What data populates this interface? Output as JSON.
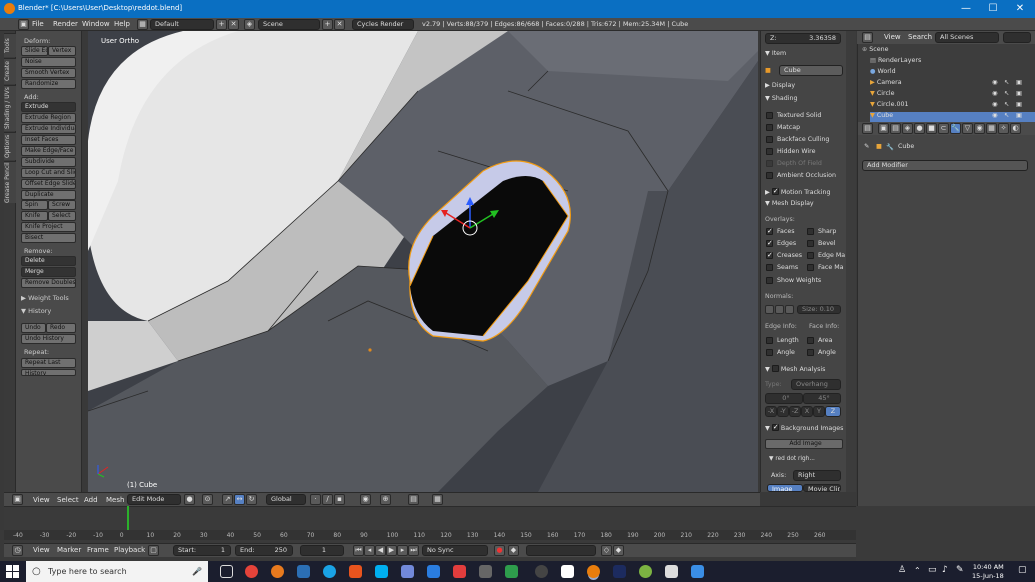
{
  "window": {
    "title": "Blender* [C:\\Users\\User\\Desktop\\reddot.blend]",
    "minimize": "—",
    "maximize": "☐",
    "close": "✕"
  },
  "menu": {
    "file": "File",
    "render": "Render",
    "window": "Window",
    "help": "Help",
    "screen_layout": "Default",
    "scene": "Scene",
    "engine": "Cycles Render",
    "stats": "v2.79 | Verts:88/379 | Edges:86/668 | Faces:0/288 | Tris:672 | Mem:25.34M | Cube"
  },
  "left_tabs": [
    "Tools",
    "Create",
    "Shading / UVs",
    "Options",
    "Grease Pencil"
  ],
  "toolshelf": {
    "deform": "Deform:",
    "slide_edge": "Slide Ed",
    "vertex": "Vertex",
    "noise": "Noise",
    "smooth_vertex": "Smooth Vertex",
    "randomize": "Randomize",
    "add": "Add:",
    "extrude": "Extrude",
    "extrude_region": "Extrude Region",
    "extrude_individual": "Extrude Individual",
    "inset_faces": "Inset Faces",
    "make_edge_face": "Make Edge/Face",
    "subdivide": "Subdivide",
    "loop_cut": "Loop Cut and Slide",
    "offset_edge": "Offset Edge Slide",
    "duplicate": "Duplicate",
    "spin": "Spin",
    "screw": "Screw",
    "knife": "Knife",
    "select": "Select",
    "knife_project": "Knife Project",
    "bisect": "Bisect",
    "remove": "Remove:",
    "delete": "Delete",
    "merge": "Merge",
    "remove_doubles": "Remove Doubles",
    "weight_tools": "Weight Tools",
    "history": "History",
    "undo": "Undo",
    "redo": "Redo",
    "undo_history": "Undo History",
    "repeat": "Repeat:",
    "repeat_last": "Repeat Last",
    "history_btn": "History"
  },
  "viewport": {
    "view_label": "User Ortho",
    "object_label": "(1) Cube",
    "header": {
      "view": "View",
      "select": "Select",
      "add": "Add",
      "mesh": "Mesh",
      "mode": "Edit Mode",
      "orientation": "Global"
    }
  },
  "npanel": {
    "z_label": "Z:",
    "z_value": "3.36358",
    "item": "Item",
    "item_name": "Cube",
    "display": "Display",
    "shading": "Shading",
    "textured_solid": "Textured Solid",
    "matcap": "Matcap",
    "backface_culling": "Backface Culling",
    "hidden_wire": "Hidden Wire",
    "depth_of_field": "Depth Of Field",
    "ambient_occlusion": "Ambient Occlusion",
    "motion_tracking": "Motion Tracking",
    "mesh_display": "Mesh Display",
    "overlays": "Overlays:",
    "faces": "Faces",
    "sharp": "Sharp",
    "edges": "Edges",
    "bevel": "Bevel",
    "creases": "Creases",
    "edge_marks": "Edge Ma",
    "seams": "Seams",
    "face_marks": "Face Ma",
    "show_weights": "Show Weights",
    "normals": "Normals:",
    "normal_size": "Size: 0.10",
    "edge_info": "Edge Info:",
    "face_info": "Face Info:",
    "length": "Length",
    "area": "Area",
    "angle": "Angle",
    "angle2": "Angle",
    "mesh_analysis": "Mesh Analysis",
    "type_label": "Type:",
    "type_value": "Overhang",
    "min_angle": "0°",
    "max_angle": "45°",
    "axes": [
      "-X",
      "-Y",
      "-Z",
      "X",
      "Y",
      "Z"
    ],
    "background_images": "Background Images",
    "add_image": "Add Image",
    "image_item": "red dot righ...",
    "axis_label": "Axis:",
    "axis_value": "Right",
    "tab_image": "Image",
    "tab_movie": "Movie Clip"
  },
  "outliner": {
    "view": "View",
    "search": "Search",
    "filter": "All Scenes",
    "rows": [
      "Scene",
      "RenderLayers",
      "World",
      "Camera",
      "Circle",
      "Circle.001",
      "Cube"
    ]
  },
  "properties": {
    "object_name": "Cube",
    "add_modifier": "Add Modifier"
  },
  "timeline": {
    "ticks": [
      "-40",
      "-30",
      "-20",
      "-10",
      "0",
      "10",
      "20",
      "30",
      "40",
      "50",
      "60",
      "70",
      "80",
      "90",
      "100",
      "110",
      "120",
      "130",
      "140",
      "150",
      "160",
      "170",
      "180",
      "190",
      "200",
      "210",
      "220",
      "230",
      "240",
      "250",
      "260"
    ],
    "view": "View",
    "marker": "Marker",
    "frame": "Frame",
    "playback": "Playback",
    "start": "Start:",
    "start_value": "1",
    "end": "End:",
    "end_value": "250",
    "current": "1",
    "sync": "No Sync"
  },
  "taskbar": {
    "search_placeholder": "Type here to search",
    "time": "10:40 AM",
    "date": "15-Jun-18"
  },
  "colors": {
    "title_blue": "#0a6fc2",
    "selection_orange": "#f5a623",
    "face_highlight": "#c9cde8",
    "timeline_frame": "#2bb02b"
  }
}
